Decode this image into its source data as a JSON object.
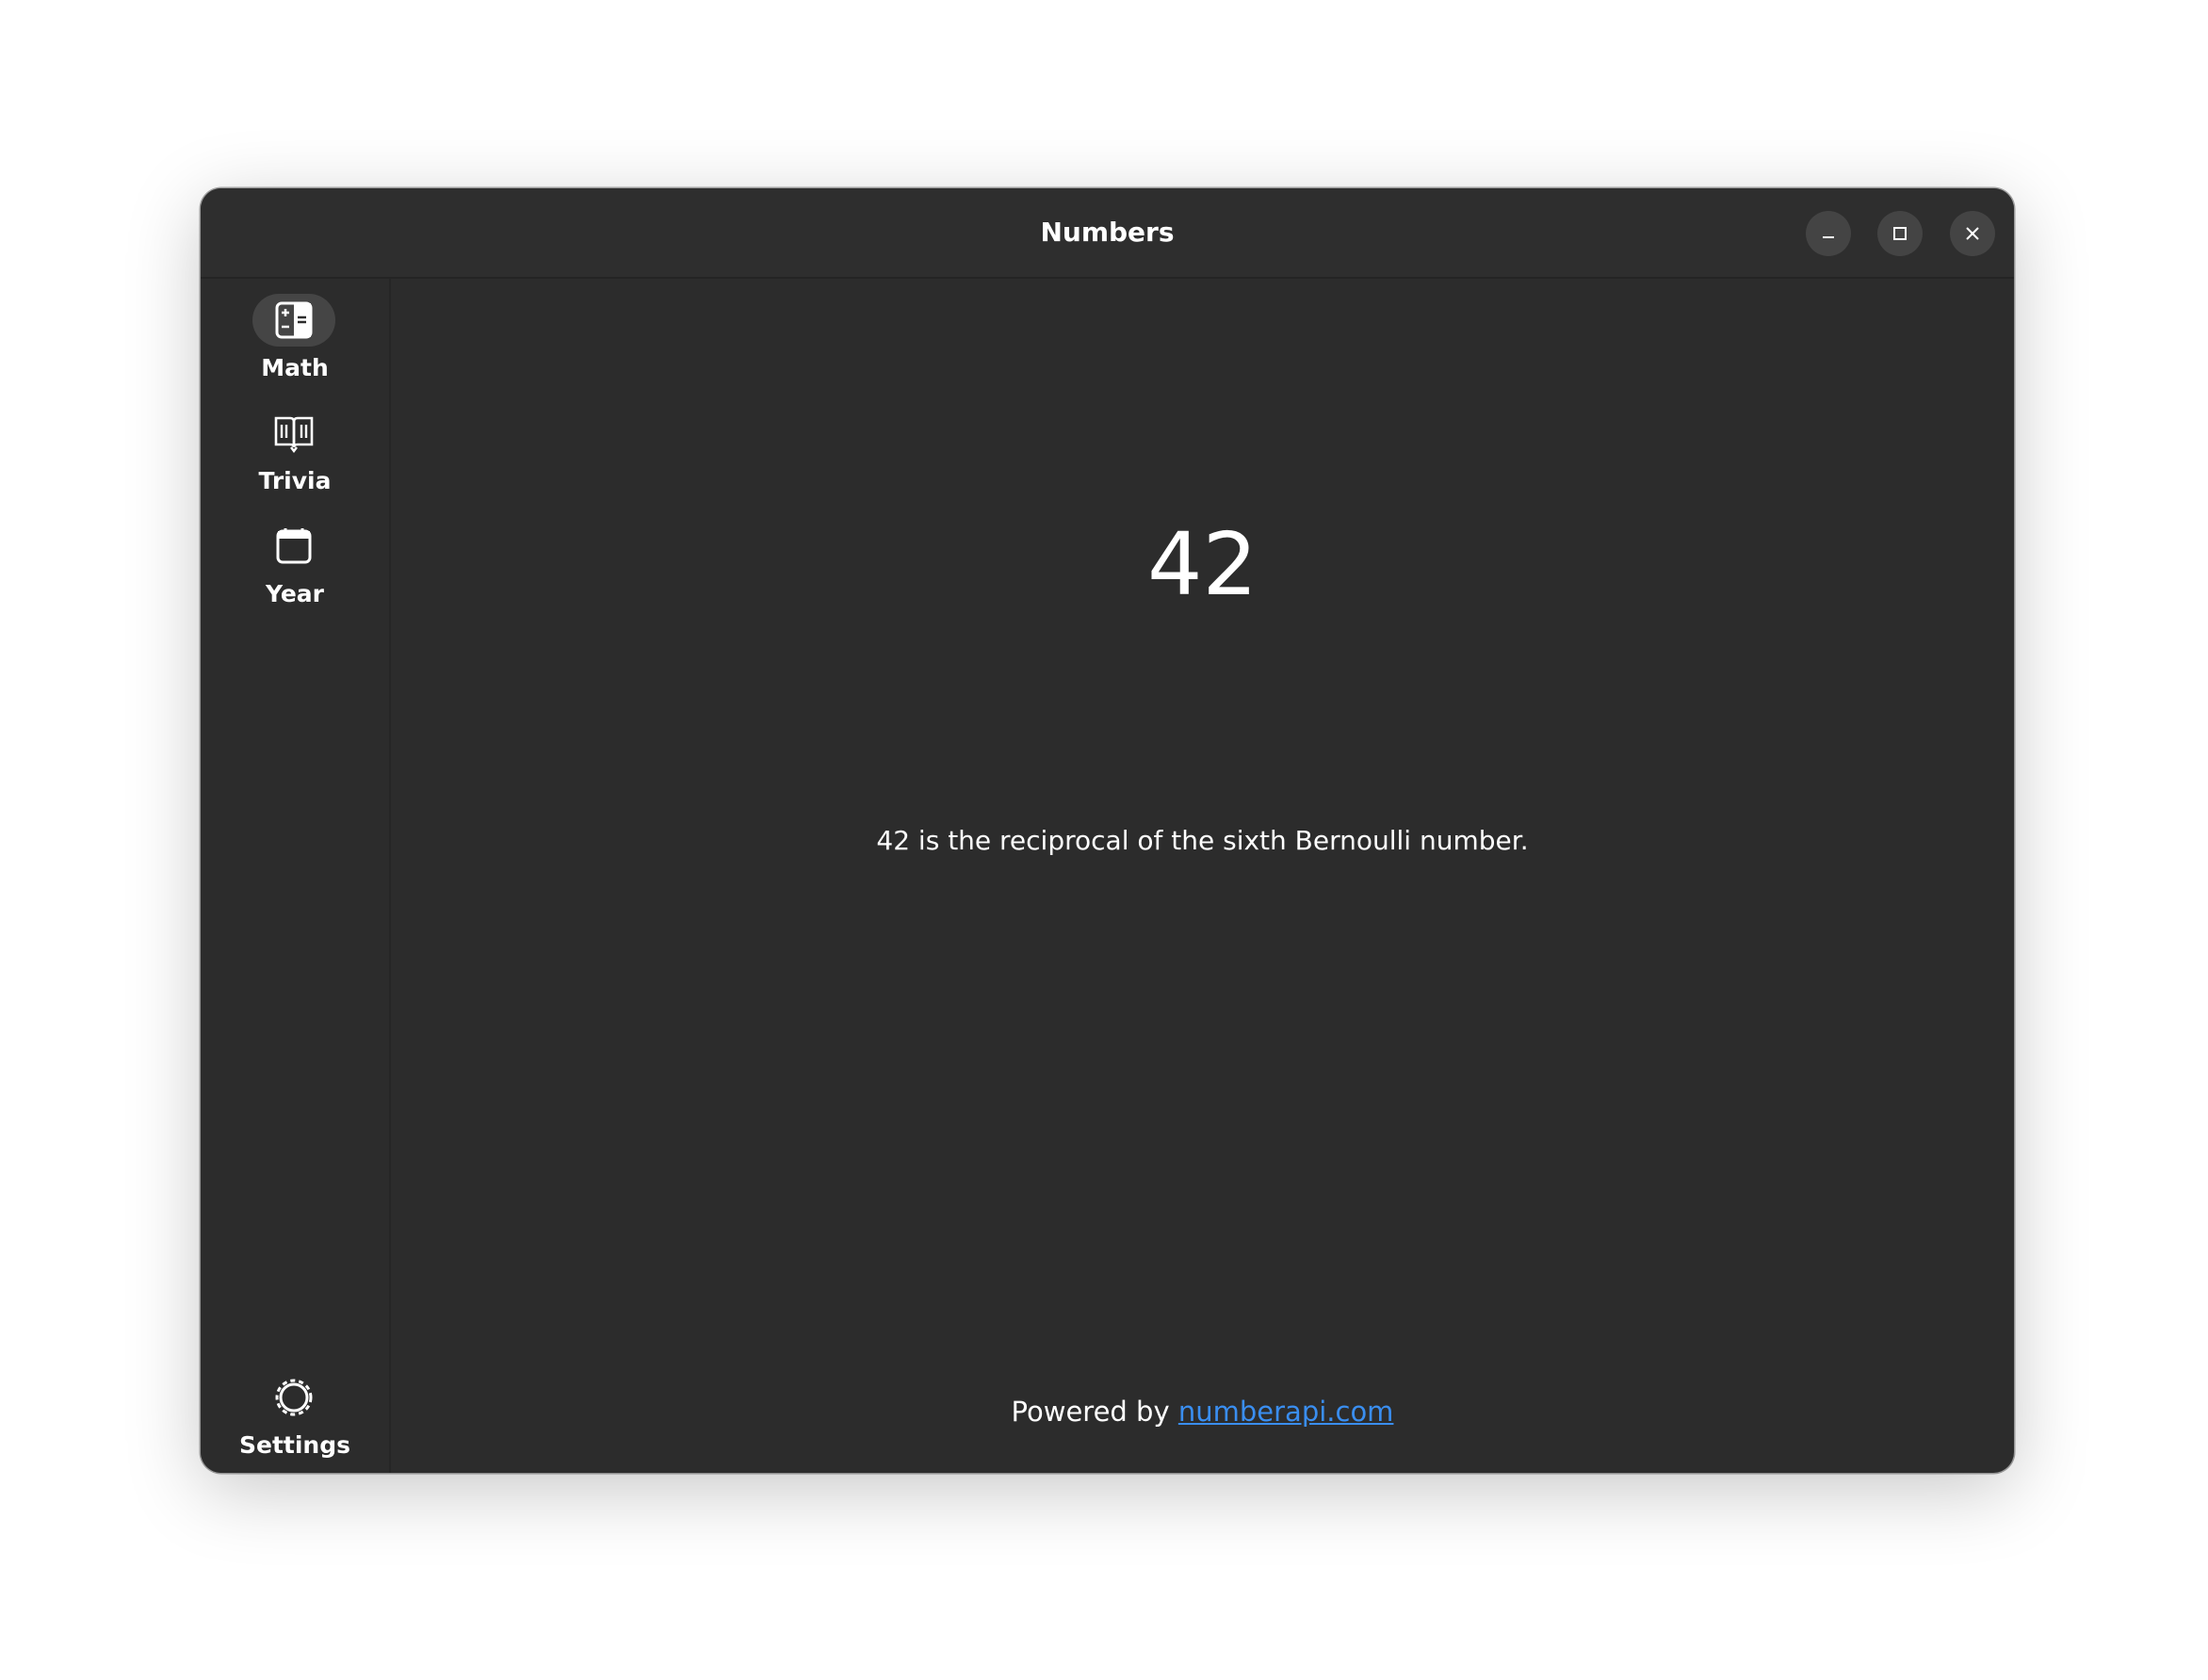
{
  "window": {
    "title": "Numbers"
  },
  "sidebar": {
    "items": [
      {
        "label": "Math",
        "icon": "calculator-icon",
        "active": true
      },
      {
        "label": "Trivia",
        "icon": "book-icon",
        "active": false
      },
      {
        "label": "Year",
        "icon": "calendar-icon",
        "active": false
      }
    ],
    "settings": {
      "label": "Settings",
      "icon": "gear-icon"
    }
  },
  "main": {
    "number": "42",
    "fact": "42 is the reciprocal of the sixth Bernoulli number.",
    "footer_prefix": "Powered by ",
    "footer_link": "numberapi.com"
  },
  "colors": {
    "window_bg": "#2c2c2c",
    "accent_green": "#1a8a2a",
    "link_blue": "#3a8ef0"
  }
}
